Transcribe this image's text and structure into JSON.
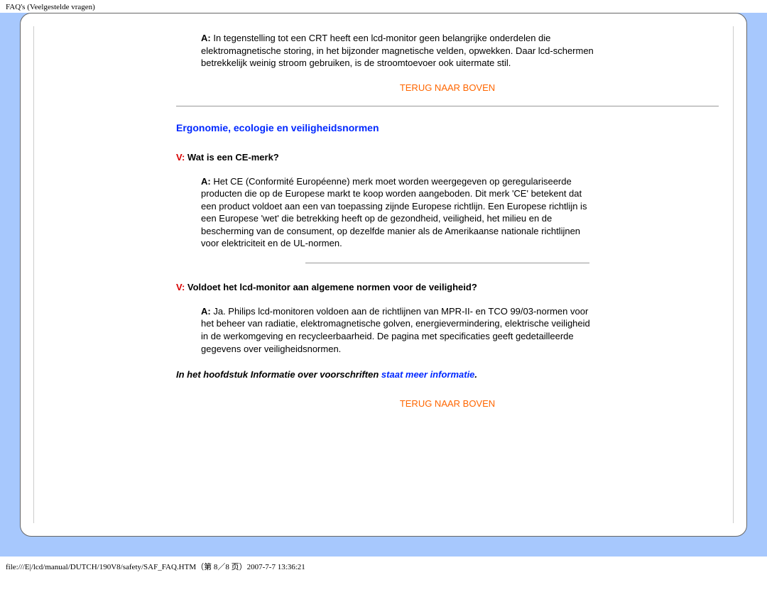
{
  "header_title": "FAQ's (Veelgestelde vragen)",
  "answer_prefix": "A:",
  "question_prefix": "V:",
  "answer1": " In tegenstelling tot een CRT heeft een lcd-monitor geen belangrijke onderdelen die elektromagnetische storing, in het bijzonder magnetische velden, opwekken. Daar lcd-schermen betrekkelijk weinig stroom gebruiken, is de stroomtoevoer ook uitermate stil.",
  "back_to_top": "TERUG NAAR BOVEN",
  "section_title": "Ergonomie, ecologie en veiligheidsnormen",
  "q2": " Wat is een CE-merk?",
  "a2": " Het CE (Conformité Européenne) merk moet worden weergegeven op geregulariseerde producten die op de Europese markt te koop worden aangeboden. Dit merk 'CE' betekent dat een product voldoet aan een van toepassing zijnde Europese richtlijn. Een Europese richtlijn is een Europese 'wet' die betrekking heeft op de gezondheid, veiligheid, het milieu en de bescherming van de consument, op dezelfde manier als de Amerikaanse nationale richtlijnen voor elektriciteit en de UL-normen.",
  "q3": " Voldoet het lcd-monitor aan algemene normen voor de veiligheid?",
  "a3": " Ja. Philips lcd-monitoren voldoen aan de richtlijnen van MPR-II- en TCO 99/03-normen voor het beheer van radiatie, elektromagnetische golven, energievermindering, elektrische veiligheid in de werkomgeving en recycleerbaarheid. De pagina met specificaties geeft gedetailleerde gegevens over veiligheidsnormen.",
  "note_prefix": "In het hoofdstuk Informatie over voorschriften ",
  "note_link": "staat meer informatie",
  "note_suffix": ".",
  "footer": "file:///E|/lcd/manual/DUTCH/190V8/safety/SAF_FAQ.HTM（第 8／8 页）2007-7-7 13:36:21"
}
